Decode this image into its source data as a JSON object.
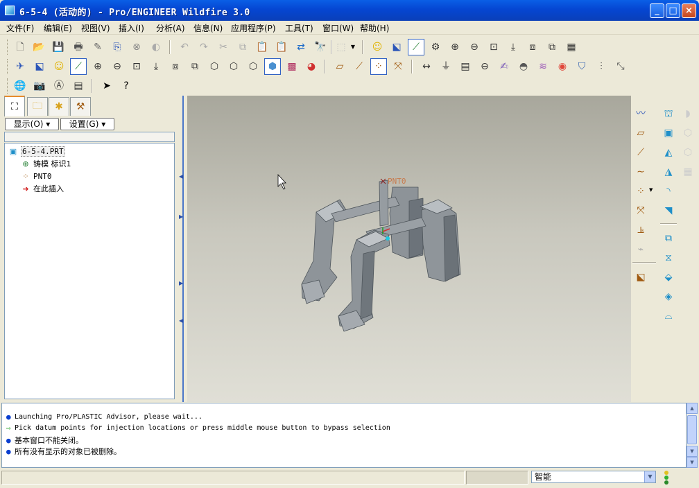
{
  "window": {
    "title": "6-5-4 (活动的) - Pro/ENGINEER Wildfire 3.0",
    "controls": {
      "minimize": "_",
      "maximize": "□",
      "close": "×"
    }
  },
  "menu": [
    "文件(F)",
    "编辑(E)",
    "视图(V)",
    "插入(I)",
    "分析(A)",
    "信息(N)",
    "应用程序(P)",
    "工具(T)",
    "窗口(W)",
    "帮助(H)"
  ],
  "toolbar_icons": {
    "row1": [
      "new-file-icon",
      "open-icon",
      "save-icon",
      "print-icon",
      "send-icon",
      "save-copy-icon",
      "erase-icon",
      "hide-icon",
      "undo-icon",
      "redo-icon",
      "cut-icon",
      "copy-icon",
      "paste-icon",
      "paste-special-icon",
      "regenerate-icon",
      "find-icon",
      "select-box-icon",
      "dropdown-icon",
      "smiley-icon",
      "named-view-icon",
      "datum-axis-icon",
      "spin-center-icon",
      "zoom-in-icon",
      "zoom-out-icon",
      "refit-icon",
      "reorient-icon",
      "view-manager-icon",
      "layers-icon",
      "model-tree-icon"
    ],
    "row2": [
      "wizard-icon",
      "sketch-icon",
      "smiley-icon",
      "datum-axis-icon",
      "zoom-in-icon",
      "zoom-out-icon",
      "refit-icon",
      "reorient-icon",
      "named-views-icon",
      "layers-icon",
      "wireframe-icon",
      "hidden-line-icon",
      "no-hidden-icon",
      "shading-icon",
      "texture-icon",
      "color-icon",
      "datum-plane-toggle-icon",
      "datum-axis-toggle-icon",
      "datum-point-toggle-icon",
      "datum-csys-toggle-icon",
      "dimension-icon",
      "datum-target-icon",
      "table-icon",
      "surface-finish-icon",
      "note-icon",
      "cosmetic-icon",
      "wave-icon",
      "color-map-icon",
      "sign-icon",
      "gauge-icon",
      "draft-icon"
    ],
    "row3": [
      "globe-icon",
      "camera-icon",
      "annotation-icon",
      "drawing-icon",
      "select-arrow-icon",
      "whats-this-icon"
    ]
  },
  "navigator": {
    "tabs": [
      "model-tree-icon",
      "folder-browser-icon",
      "favorites-icon",
      "connections-icon"
    ],
    "show_button": "显示(O)",
    "settings_button": "设置(G)"
  },
  "tree": [
    {
      "label": "6-5-4.PRT",
      "icon": "part-icon"
    },
    {
      "label": "铸模 标识1",
      "icon": "mold-feature-icon"
    },
    {
      "label": "PNT0",
      "icon": "datum-point-icon"
    },
    {
      "label": "在此插入",
      "icon": "insert-here-arrow-icon"
    }
  ],
  "viewport": {
    "point_label": "PNT0"
  },
  "messages": [
    {
      "text": "Launching Pro/PLASTIC Advisor,  please wait...",
      "icon": "bullet-icon"
    },
    {
      "text": "Pick datum points for injection locations or press middle mouse button to bypass selection",
      "icon": "prompt-arrow-icon"
    },
    {
      "text": "基本窗口不能关闭。",
      "icon": "bullet-icon"
    },
    {
      "text": "所有没有显示的对象已被删除。",
      "icon": "bullet-icon"
    }
  ],
  "status": {
    "filter_value": "智能"
  },
  "colors": {
    "title_blue": "#0546d2",
    "viewport_top": "#a8a79c",
    "viewport_bottom": "#e0dfd6",
    "model_gray": "#8d9398",
    "point_label": "#c87a4c"
  }
}
